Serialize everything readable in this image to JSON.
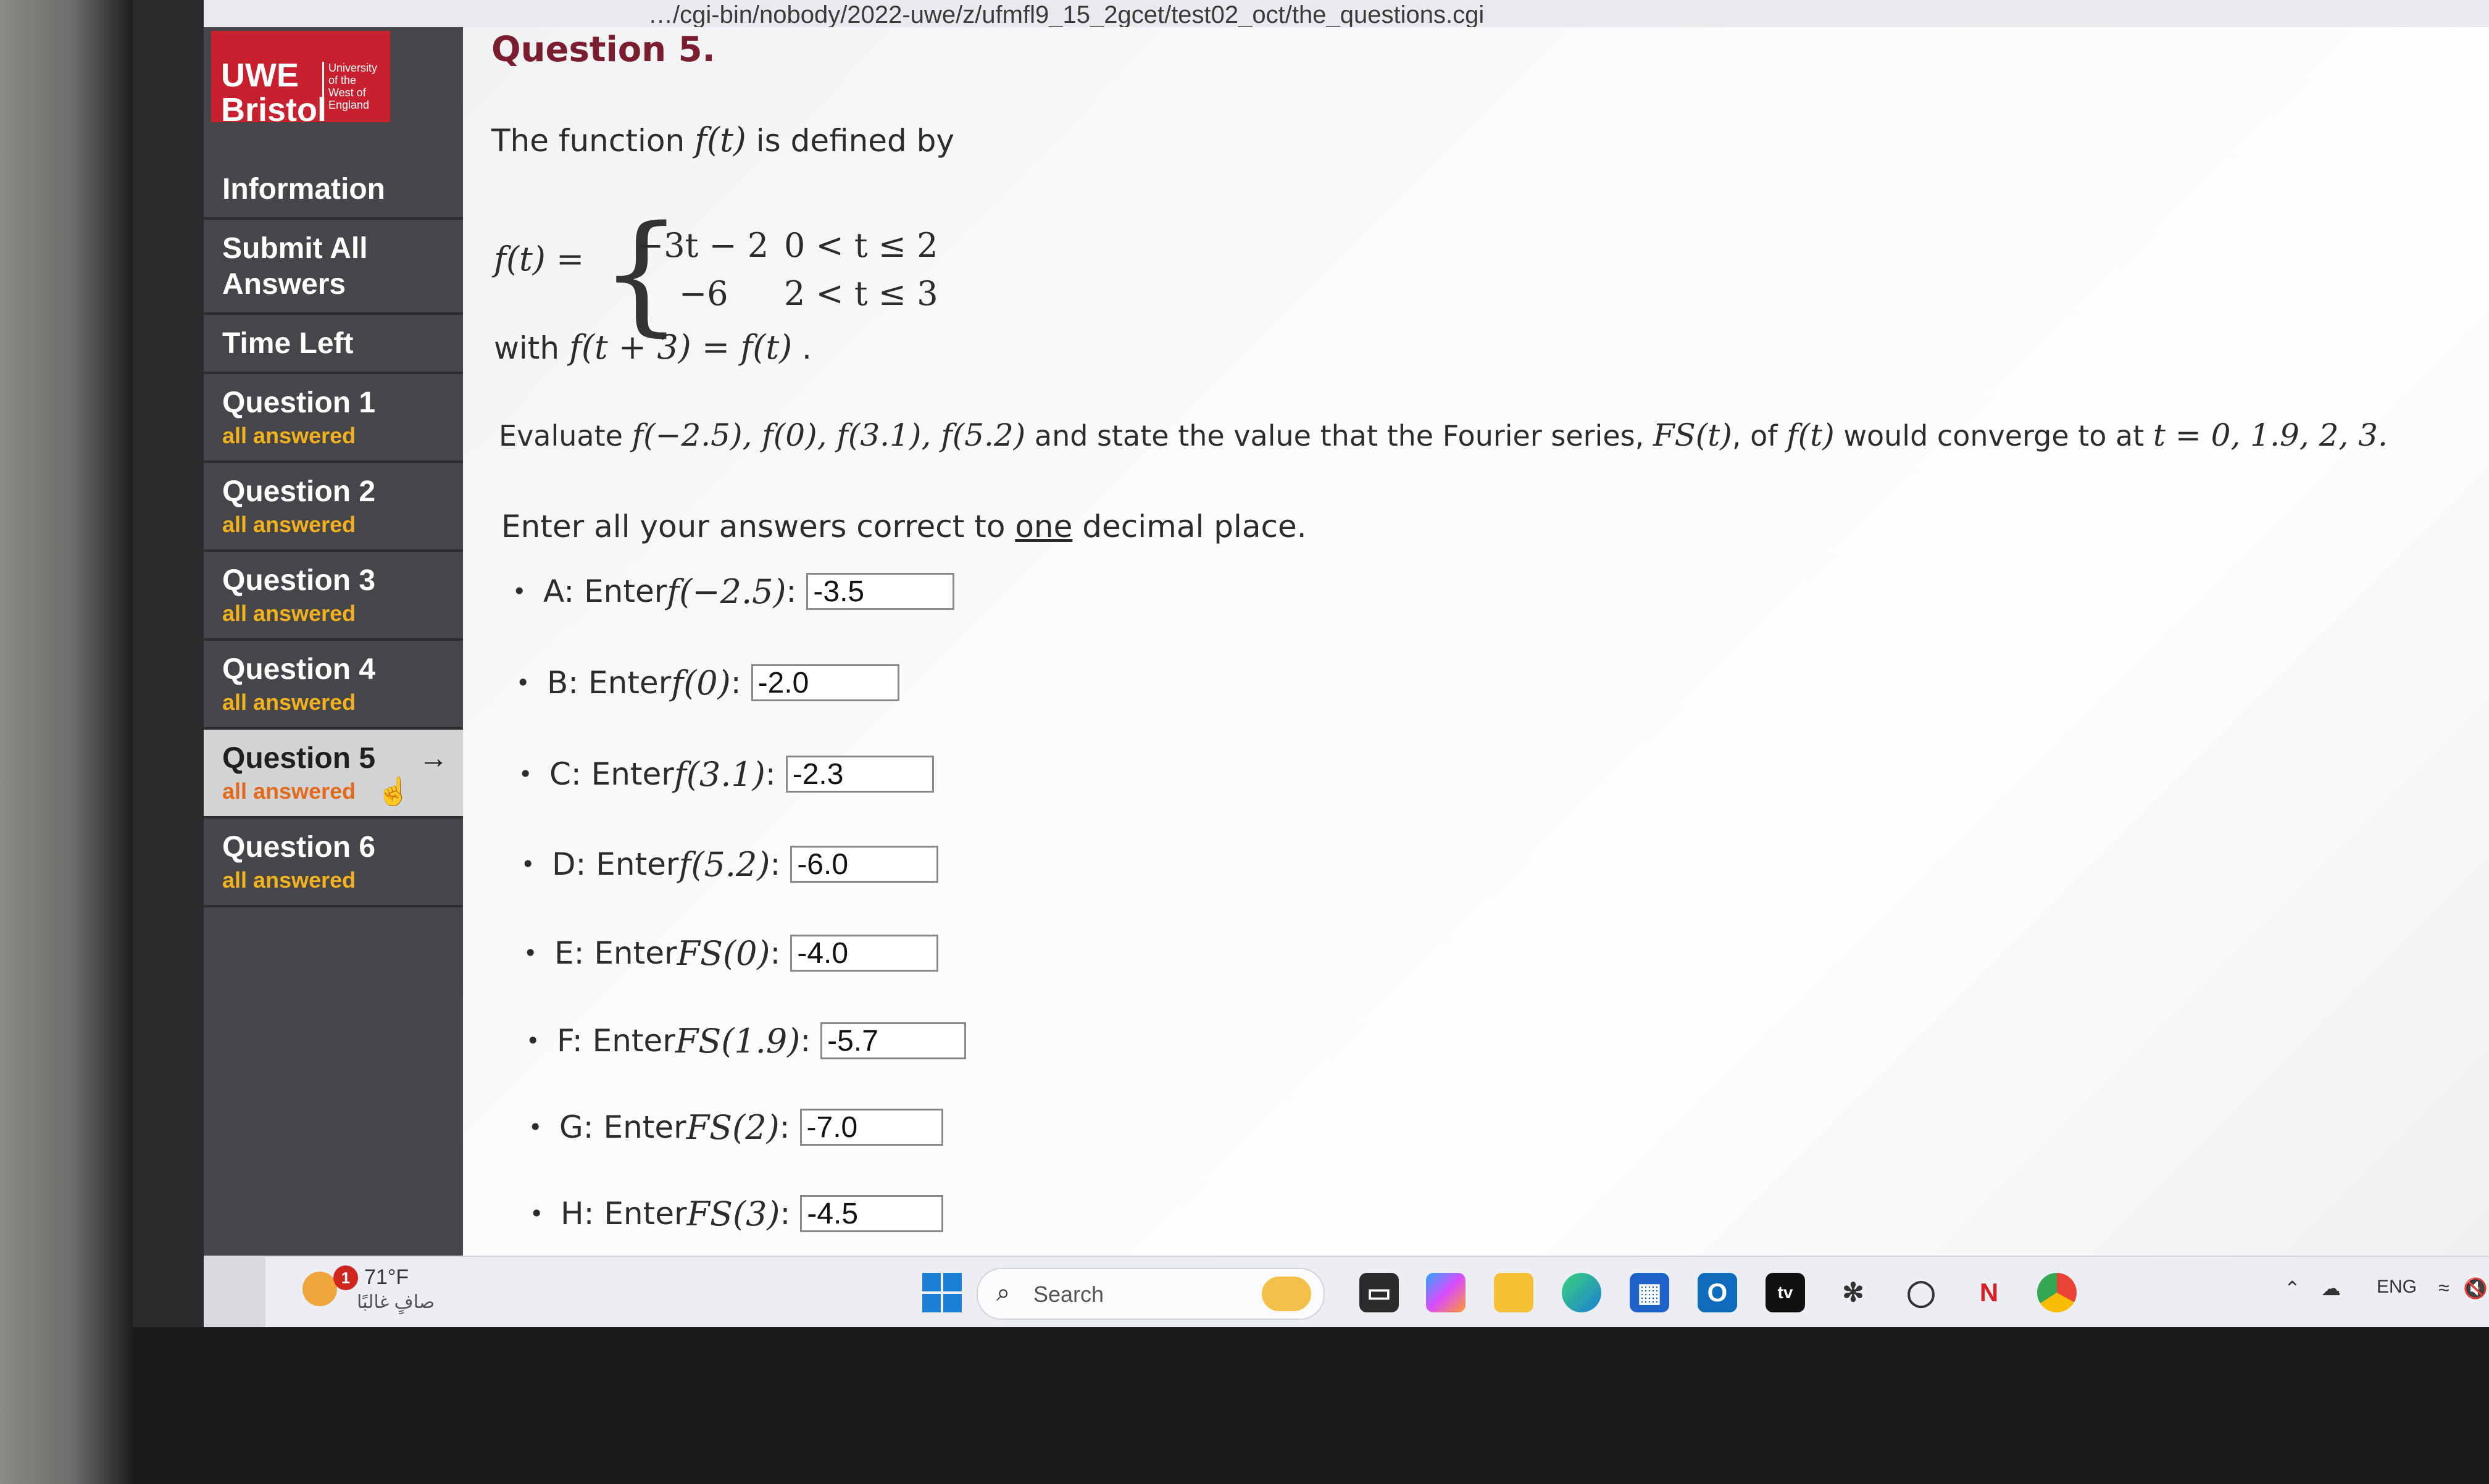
{
  "url": "…/cgi-bin/nobody/2022-uwe/z/ufmfl9_15_2gcet/test02_oct/the_questions.cgi",
  "logo": {
    "main": "UWE\nBristol",
    "sub": "University\nof the\nWest of\nEngland"
  },
  "sidebar": {
    "items": [
      {
        "label": "Information",
        "status": ""
      },
      {
        "label": "Submit All Answers",
        "status": ""
      },
      {
        "label": "Time Left",
        "status": ""
      },
      {
        "label": "Question 1",
        "status": "all answered"
      },
      {
        "label": "Question 2",
        "status": "all answered"
      },
      {
        "label": "Question 3",
        "status": "all answered"
      },
      {
        "label": "Question 4",
        "status": "all answered"
      },
      {
        "label": "Question 5",
        "status": "all answered",
        "active": true,
        "arrow": "→"
      },
      {
        "label": "Question 6",
        "status": "all answered"
      }
    ]
  },
  "question": {
    "title": "Question 5.",
    "intro_prefix": "The function ",
    "intro_fn": "f(t)",
    "intro_suffix": " is defined by",
    "piecewise_lhs": "f(t) =",
    "case1_expr": "−3t − 2",
    "case1_cond": "0 < t ≤ 2",
    "case2_expr": "−6",
    "case2_cond": "2 < t ≤ 3",
    "with_prefix": "with ",
    "with_expr": "f(t + 3) = f(t)",
    "with_suffix": " .",
    "evaluate_prefix": "Evaluate ",
    "evaluate_fns": "f(−2.5), f(0), f(3.1), f(5.2)",
    "evaluate_mid": " and state the value that the Fourier series, ",
    "evaluate_fs": "FS(t)",
    "evaluate_of": ", of ",
    "evaluate_ft": "f(t)",
    "evaluate_tail": " would converge to at ",
    "evaluate_tvals": "t = 0, 1.9, 2, 3.",
    "instruction_prefix": "Enter all your answers correct to ",
    "instruction_underlined": "one",
    "instruction_suffix": " decimal place."
  },
  "answers": [
    {
      "key": "A: Enter ",
      "expr": "f(−2.5)",
      "colon": ":",
      "value": "-3.5"
    },
    {
      "key": "B: Enter ",
      "expr": "f(0)",
      "colon": ":",
      "value": "-2.0"
    },
    {
      "key": "C: Enter ",
      "expr": "f(3.1)",
      "colon": ":",
      "value": "-2.3"
    },
    {
      "key": "D: Enter ",
      "expr": "f(5.2)",
      "colon": ":",
      "value": "-6.0"
    },
    {
      "key": "E: Enter ",
      "expr": "FS(0)",
      "colon": ":",
      "value": "-4.0"
    },
    {
      "key": "F: Enter ",
      "expr": "FS(1.9)",
      "colon": ":",
      "value": "-5.7"
    },
    {
      "key": "G: Enter ",
      "expr": "FS(2)",
      "colon": ":",
      "value": "-7.0"
    },
    {
      "key": "H: Enter ",
      "expr": "FS(3)",
      "colon": ":",
      "value": "-4.5"
    }
  ],
  "taskbar": {
    "weather_badge": "1",
    "weather_temp": "71°F",
    "weather_cond": "صافٍ غالبًا",
    "search_placeholder": "Search",
    "apps": [
      "file-explorer-icon",
      "copilot-icon",
      "folder-icon",
      "edge-icon",
      "store-icon",
      "outlook-icon",
      "apple-tv-icon",
      "chatgpt-icon",
      "whatsapp-icon",
      "netflix-icon",
      "chrome-icon"
    ],
    "language": "ENG"
  },
  "colors": {
    "sidebar": "#46464a",
    "logo": "#c8202f",
    "status": "#f3b21d",
    "title": "#7a1d2f"
  }
}
